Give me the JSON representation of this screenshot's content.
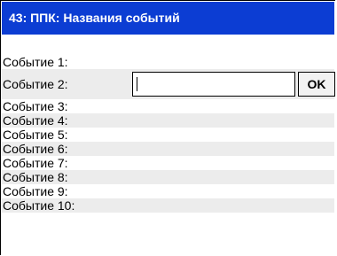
{
  "window": {
    "title": "43: ППК: Названия событий"
  },
  "edit": {
    "value": "",
    "ok_label": "OK"
  },
  "events": [
    {
      "label": "Событие 1:"
    },
    {
      "label": "Событие 2:"
    },
    {
      "label": "Событие 3:"
    },
    {
      "label": "Событие 4:"
    },
    {
      "label": "Событие 5:"
    },
    {
      "label": "Событие 6:"
    },
    {
      "label": "Событие 7:"
    },
    {
      "label": "Событие 8:"
    },
    {
      "label": "Событие 9:"
    },
    {
      "label": "Событие 10:"
    }
  ],
  "colors": {
    "title_bar": "#0c3dd3",
    "title_text": "#ffffff",
    "row_shade": "#ececec"
  }
}
